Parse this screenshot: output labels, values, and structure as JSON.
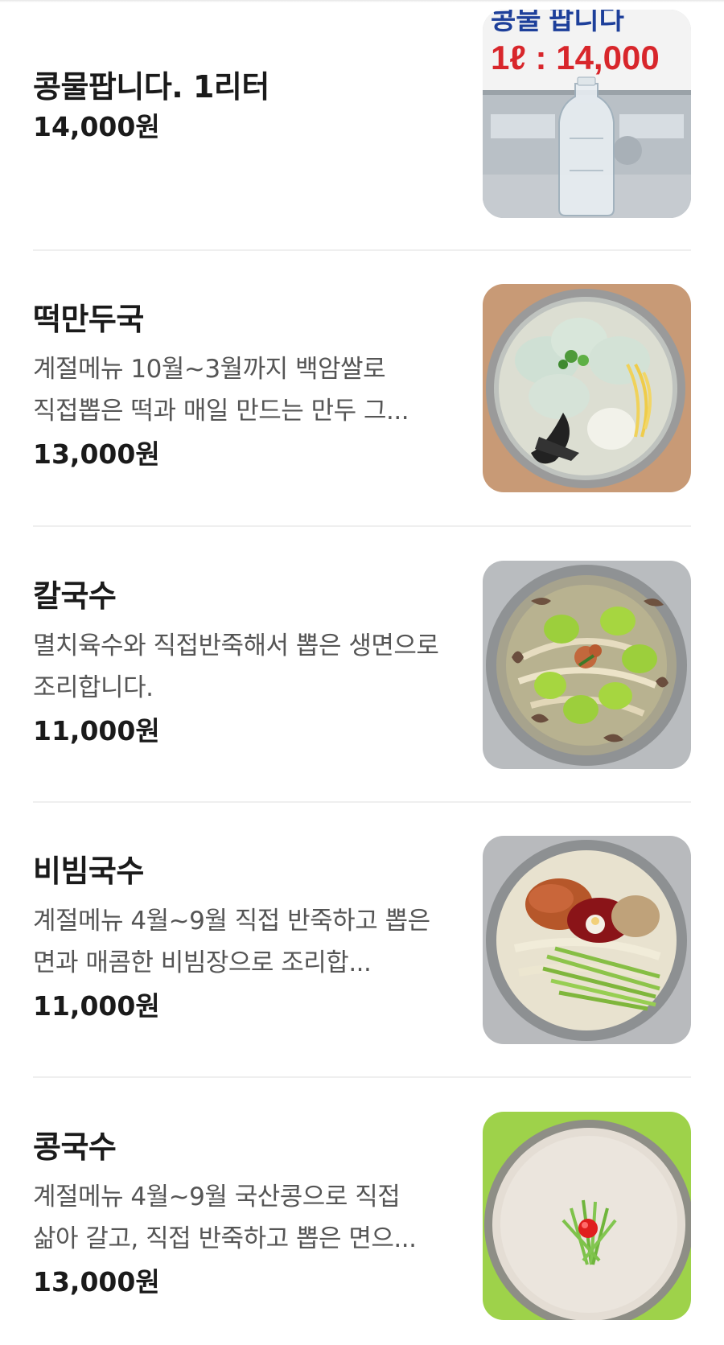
{
  "menu": {
    "items": [
      {
        "name": "콩물팝니다. 1리터",
        "description": "",
        "price": "14,000원",
        "image": {
          "subject": "soy-milk-bottle-photo",
          "sign_line1": "콩물 팝니다",
          "sign_line2": "1ℓ : 14,000"
        }
      },
      {
        "name": "떡만두국",
        "description": "계절메뉴 10월~3월까지 백암쌀로 직접뽑은 떡과 매일 만드는 만두 그...",
        "price": "13,000원",
        "image": {
          "subject": "rice-cake-dumpling-soup-photo"
        }
      },
      {
        "name": "칼국수",
        "description": "멸치육수와 직접반죽해서 뽑은 생면으로 조리합니다.",
        "price": "11,000원",
        "image": {
          "subject": "knife-cut-noodle-soup-photo"
        }
      },
      {
        "name": "비빔국수",
        "description": "계절메뉴 4월~9월 직접 반죽하고 뽑은 면과 매콤한 비빔장으로 조리합...",
        "price": "11,000원",
        "image": {
          "subject": "spicy-mixed-noodles-photo"
        }
      },
      {
        "name": "콩국수",
        "description": "계절메뉴 4월~9월 국산콩으로 직접 삶아 갈고, 직접 반죽하고 뽑은 면으...",
        "price": "13,000원",
        "image": {
          "subject": "cold-soy-milk-noodles-photo"
        }
      }
    ]
  },
  "colors": {
    "text_primary": "#1a1a1a",
    "text_secondary": "#555555",
    "divider": "#efefef",
    "sign_red": "#d8262b",
    "sign_blue": "#1d3f9a"
  }
}
